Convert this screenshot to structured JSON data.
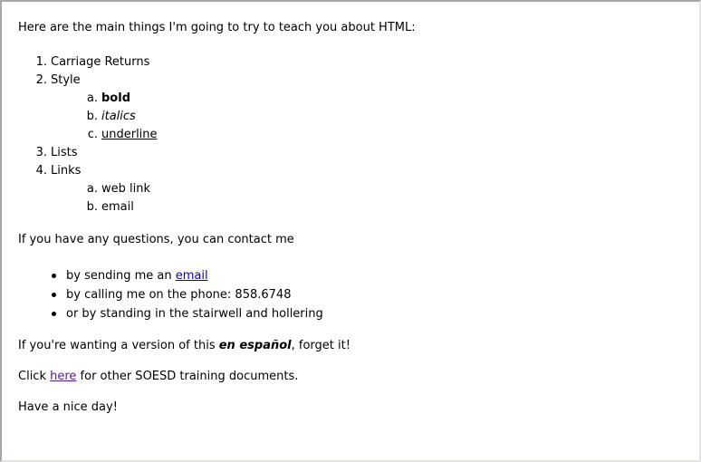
{
  "intro": "Here are the main things I'm going to try to teach you about HTML:",
  "topics": {
    "item1": {
      "num": "1.",
      "label": "Carriage Returns"
    },
    "item2": {
      "num": "2.",
      "label": "Style"
    },
    "style_subs": {
      "a": {
        "num": "a.",
        "label": "bold"
      },
      "b": {
        "num": "b.",
        "label": "italics"
      },
      "c": {
        "num": "c.",
        "label": "underline"
      }
    },
    "item3": {
      "num": "3.",
      "label": "Lists"
    },
    "item4": {
      "num": "4.",
      "label": "Links"
    },
    "link_subs": {
      "a": {
        "num": "a.",
        "label": "web link"
      },
      "b": {
        "num": "b.",
        "label": "email"
      }
    }
  },
  "contact_intro": "If you have any questions, you can contact me",
  "contact": {
    "email_prefix": "by sending me an ",
    "email_link": "email",
    "phone": "by calling me on the phone: 858.6748",
    "stairwell": "or by standing in the stairwell and hollering"
  },
  "spanish": {
    "prefix": "If you're wanting a version of this ",
    "emphasis": "en español",
    "suffix": ", forget it!"
  },
  "click": {
    "prefix": "Click ",
    "link": "here",
    "suffix": " for other SOESD training documents."
  },
  "closing": "Have a nice day!",
  "colors": {
    "link": "#0000ee",
    "visited_link": "#551a8b"
  }
}
